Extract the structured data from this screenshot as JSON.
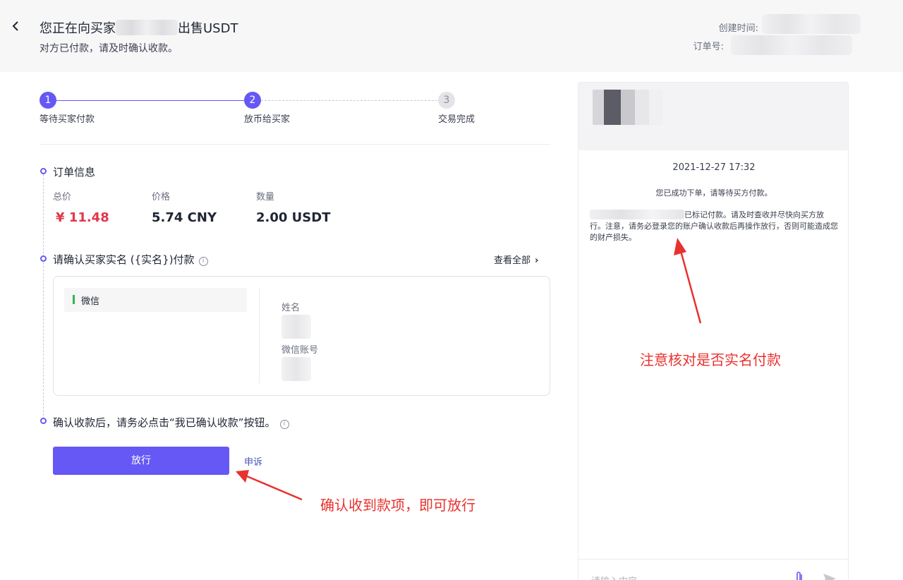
{
  "header": {
    "title_prefix": "您正在向买家",
    "title_suffix": "出售USDT",
    "subtitle": "对方已付款，请及时确认收款。",
    "created_label": "创建时间:",
    "order_label": "订单号:"
  },
  "steps": [
    {
      "number": "1",
      "label": "等待买家付款",
      "state": "done"
    },
    {
      "number": "2",
      "label": "放币给买家",
      "state": "active"
    },
    {
      "number": "3",
      "label": "交易完成",
      "state": "pending"
    }
  ],
  "order": {
    "section_title": "订单信息",
    "total_label": "总价",
    "total_value": "¥ 11.48",
    "price_label": "价格",
    "price_value": "5.74 CNY",
    "qty_label": "数量",
    "qty_value": "2.00 USDT"
  },
  "payment": {
    "section_title": "请确认买家实名 ({实名})付款",
    "view_all": "查看全部",
    "method": "微信",
    "name_label": "姓名",
    "account_label": "微信账号"
  },
  "confirm": {
    "note": "确认收款后，请务必点击“我已确认收款”按钮。",
    "release_button": "放行",
    "appeal_link": "申诉"
  },
  "chat": {
    "time": "2021-12-27 17:32",
    "msg1": "您已成功下单，请等待买方付款。",
    "msg2": "已标记付款。请及时查收并尽快向买方放行。注意，请务必登录您的账户确认收款后再操作放行，否则可能造成您的财产损失。",
    "input_placeholder": "请输入内容"
  },
  "annotations": {
    "verify": "注意核对是否实名付款",
    "release": "确认收到款项，即可放行"
  },
  "colors": {
    "accent": "#6558f5",
    "price_red": "#e0384b",
    "annotation_red": "#e8322e",
    "wechat_green": "#2db84d"
  }
}
